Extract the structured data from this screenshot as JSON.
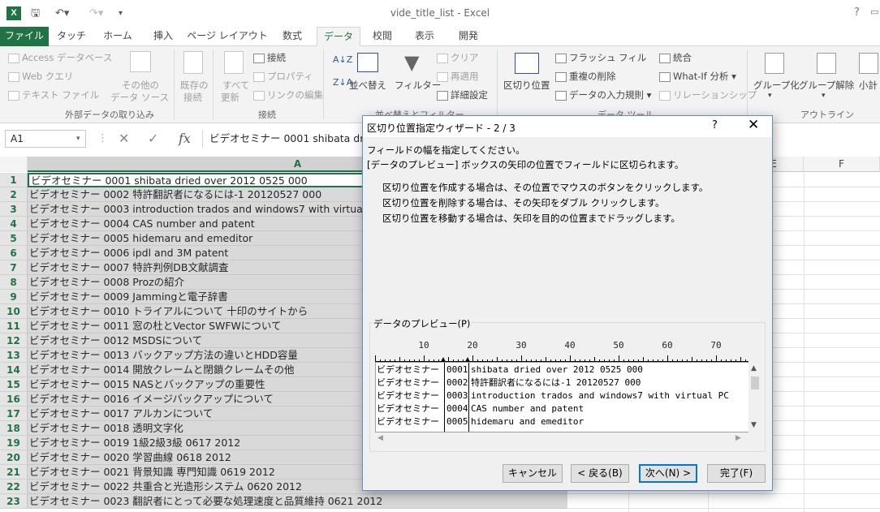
{
  "window": {
    "title": "vide_title_list - Excel",
    "app_badge": "X",
    "help_glyph": "?"
  },
  "tabs": [
    "ファイル",
    "タッチ",
    "ホーム",
    "挿入",
    "ページ レイアウト",
    "数式",
    "データ",
    "校閲",
    "表示",
    "開発"
  ],
  "ribbon": {
    "get_external": {
      "access": "Access データベース",
      "web": "Web クエリ",
      "text": "テキスト ファイル",
      "other_line1": "その他の",
      "other_line2": "データ ソース",
      "label": "外部データの取り込み"
    },
    "connections": {
      "existing_line1": "既存の",
      "existing_line2": "接続",
      "refresh_line1": "すべて",
      "refresh_line2": "更新",
      "connect": "接続",
      "properties": "プロパティ",
      "edit_links": "リンクの編集",
      "label": "接続"
    },
    "sort": {
      "sort": "並べ替え",
      "filter": "フィルター",
      "clear": "クリア",
      "reapply": "再適用",
      "advanced": "詳細設定",
      "label": "並べ替えとフィルター"
    },
    "tools": {
      "text_to_columns": "区切り位置",
      "flash_fill": "フラッシュ フィル",
      "remove_dup": "重複の削除",
      "validation": "データの入力規則",
      "consolidate": "統合",
      "whatif": "What-If 分析",
      "relationships": "リレーションシップ",
      "label": "データ ツール"
    },
    "outline": {
      "group": "グループ化",
      "ungroup": "グループ解除",
      "subtotal": "小計",
      "label": "アウトライン"
    }
  },
  "formula_bar": {
    "name_box": "A1",
    "fx": "fx",
    "content": "ビデオセミナー 0001 shibata dried over 2012 0525 000"
  },
  "columns": [
    "A",
    "E",
    "F"
  ],
  "rows": [
    {
      "n": "1",
      "a": "ビデオセミナー 0001 shibata dried over 2012 0525 000"
    },
    {
      "n": "2",
      "a": "ビデオセミナー 0002  特許翻訳者になるには-1  20120527 000"
    },
    {
      "n": "3",
      "a": "ビデオセミナー 0003 introduction trados and windows7 with virtual PC"
    },
    {
      "n": "4",
      "a": "ビデオセミナー 0004 CAS number and patent"
    },
    {
      "n": "5",
      "a": "ビデオセミナー 0005 hidemaru and emeditor"
    },
    {
      "n": "6",
      "a": "ビデオセミナー 0006 ipdl and 3M patent"
    },
    {
      "n": "7",
      "a": "ビデオセミナー 0007 特許判例DB文献調査"
    },
    {
      "n": "8",
      "a": "ビデオセミナー 0008 Prozの紹介"
    },
    {
      "n": "9",
      "a": "ビデオセミナー 0009 Jammingと電子辞書"
    },
    {
      "n": "10",
      "a": "ビデオセミナー 0010 トライアルについて  十印のサイトから"
    },
    {
      "n": "11",
      "a": "ビデオセミナー 0011 窓の杜とVector SWFWについて"
    },
    {
      "n": "12",
      "a": "ビデオセミナー 0012 MSDSについて"
    },
    {
      "n": "13",
      "a": "ビデオセミナー 0013 バックアップ方法の違いとHDD容量"
    },
    {
      "n": "14",
      "a": "ビデオセミナー 0014 開放クレームと閉鎖クレームその他"
    },
    {
      "n": "15",
      "a": "ビデオセミナー 0015 NASとバックアップの重要性"
    },
    {
      "n": "16",
      "a": "ビデオセミナー 0016 イメージバックアップについて"
    },
    {
      "n": "17",
      "a": "ビデオセミナー 0017 アルカンについて"
    },
    {
      "n": "18",
      "a": "ビデオセミナー 0018 透明文字化"
    },
    {
      "n": "19",
      "a": "ビデオセミナー 0019 1級2級3級 0617 2012"
    },
    {
      "n": "20",
      "a": "ビデオセミナー 0020 学習曲線 0618 2012"
    },
    {
      "n": "21",
      "a": "ビデオセミナー 0021 背景知識  専門知識 0619 2012"
    },
    {
      "n": "22",
      "a": "ビデオセミナー 0022 共重合と光造形システム  0620 2012"
    },
    {
      "n": "23",
      "a": "ビデオセミナー 0023 翻訳者にとって必要な処理速度と品質維持 0621 2012"
    }
  ],
  "dialog": {
    "title": "区切り位置指定ウィザード - 2 / 3",
    "help": "?",
    "close": "✕",
    "line1": "フィールドの幅を指定してください。",
    "line2": "[データのプレビュー] ボックスの矢印の位置でフィールドに区切られます。",
    "hint1": "区切り位置を作成する場合は、その位置でマウスのボタンをクリックします。",
    "hint2": "区切り位置を削除する場合は、その矢印をダブル クリックします。",
    "hint3": "区切り位置を移動する場合は、矢印を目的の位置までドラッグします。",
    "preview_label": "データのプレビュー(P)",
    "ruler": [
      "10",
      "20",
      "30",
      "40",
      "50",
      "60",
      "70"
    ],
    "preview_rows": [
      {
        "c1": "ビデオセミナー",
        "c2": "0001",
        "c3": "shibata dried over 2012 0525 000"
      },
      {
        "c1": "ビデオセミナー",
        "c2": "0002",
        "c3": " 特許翻訳者になるには-1  20120527 000"
      },
      {
        "c1": "ビデオセミナー",
        "c2": "0003",
        "c3": "introduction trados and windows7 with virtual PC"
      },
      {
        "c1": "ビデオセミナー",
        "c2": "0004",
        "c3": "CAS number and patent"
      },
      {
        "c1": "ビデオセミナー",
        "c2": "0005",
        "c3": "hidemaru and emeditor"
      }
    ],
    "buttons": {
      "cancel": "キャンセル",
      "back": "< 戻る(B)",
      "next": "次へ(N) >",
      "finish": "完了(F)"
    }
  }
}
